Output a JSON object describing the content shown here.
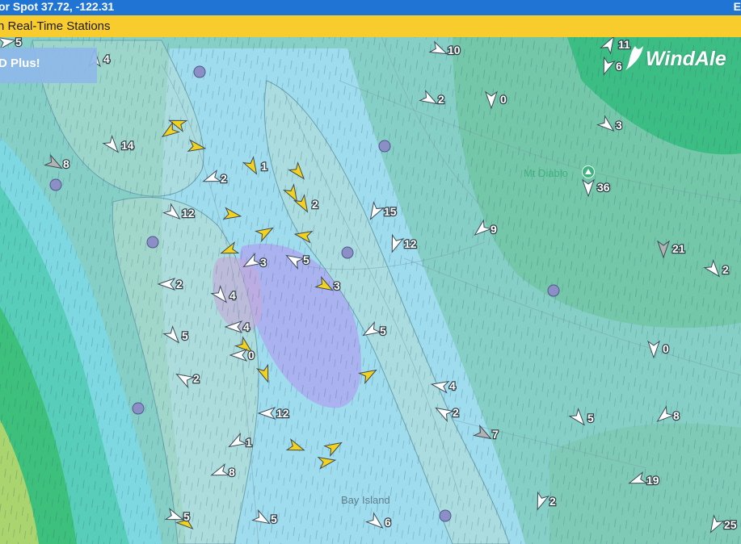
{
  "header": {
    "title": "or Spot 37.72, -122.31",
    "right_fragment": "E"
  },
  "station_bar": {
    "label": "n Real-Time Stations"
  },
  "promo": {
    "label": "D Plus!"
  },
  "logo": {
    "text": "WindAle"
  },
  "places": {
    "mt_diablo": "Mt Diablo",
    "bay_island": "Bay Island"
  },
  "colors": {
    "header_bg": "#1f74d4",
    "station_bar_bg": "#f8cc2d",
    "promo_bg": "#8eb8e8",
    "arrow_white": "#ffffff",
    "arrow_yellow": "#f2d21c",
    "arrow_grey": "#b2b2b2",
    "wind_speed_label": "#ffffff",
    "pin": "#8b8fc6"
  },
  "stations": [
    {
      "label": "5",
      "dir": 80,
      "color": "white"
    },
    {
      "label": "4",
      "dir": 0,
      "color": "white"
    },
    {
      "label": "10",
      "dir": 115,
      "color": "white"
    },
    {
      "label": "11",
      "dir": 30,
      "color": "white"
    },
    {
      "label": "6",
      "dir": 200,
      "color": "white"
    },
    {
      "label": "2",
      "dir": 120,
      "color": "white"
    },
    {
      "label": "0",
      "dir": 180,
      "color": "white"
    },
    {
      "label": "3",
      "dir": 130,
      "color": "white"
    },
    {
      "label": "14",
      "dir": 140,
      "color": "white"
    },
    {
      "label": "8",
      "dir": 120,
      "color": "grey"
    },
    {
      "label": "",
      "dir": 290,
      "color": "yellow"
    },
    {
      "label": "",
      "dir": 235,
      "color": "yellow"
    },
    {
      "label": "",
      "dir": 100,
      "color": "yellow"
    },
    {
      "label": "1",
      "dir": 150,
      "color": "yellow"
    },
    {
      "label": "2",
      "dir": 250,
      "color": "white"
    },
    {
      "label": "",
      "dir": 140,
      "color": "yellow"
    },
    {
      "label": "",
      "dir": 150,
      "color": "yellow"
    },
    {
      "label": "2",
      "dir": 150,
      "color": "yellow"
    },
    {
      "label": "36",
      "dir": 180,
      "color": "white"
    },
    {
      "label": "12",
      "dir": 130,
      "color": "white"
    },
    {
      "label": "",
      "dir": 100,
      "color": "yellow"
    },
    {
      "label": "15",
      "dir": 210,
      "color": "white"
    },
    {
      "label": "12",
      "dir": 200,
      "color": "white"
    },
    {
      "label": "9",
      "dir": 230,
      "color": "white"
    },
    {
      "label": "21",
      "dir": 180,
      "color": "grey"
    },
    {
      "label": "2",
      "dir": 140,
      "color": "white"
    },
    {
      "label": "",
      "dir": 60,
      "color": "yellow"
    },
    {
      "label": "",
      "dir": 280,
      "color": "yellow"
    },
    {
      "label": "",
      "dir": 250,
      "color": "yellow"
    },
    {
      "label": "3",
      "dir": 240,
      "color": "white"
    },
    {
      "label": "5",
      "dir": 300,
      "color": "white"
    },
    {
      "label": "3",
      "dir": 120,
      "color": "yellow"
    },
    {
      "label": "2",
      "dir": 270,
      "color": "white"
    },
    {
      "label": "4",
      "dir": 140,
      "color": "white"
    },
    {
      "label": "5",
      "dir": 240,
      "color": "white"
    },
    {
      "label": "4",
      "dir": 270,
      "color": "white"
    },
    {
      "label": "5",
      "dir": 140,
      "color": "white"
    },
    {
      "label": "",
      "dir": 130,
      "color": "yellow"
    },
    {
      "label": "0",
      "dir": 270,
      "color": "white"
    },
    {
      "label": "2",
      "dir": 300,
      "color": "white"
    },
    {
      "label": "",
      "dir": 160,
      "color": "yellow"
    },
    {
      "label": "",
      "dir": 60,
      "color": "yellow"
    },
    {
      "label": "4",
      "dir": 280,
      "color": "white"
    },
    {
      "label": "0",
      "dir": 180,
      "color": "white"
    },
    {
      "label": "12",
      "dir": 270,
      "color": "white"
    },
    {
      "label": "2",
      "dir": 300,
      "color": "white"
    },
    {
      "label": "7",
      "dir": 120,
      "color": "grey"
    },
    {
      "label": "5",
      "dir": 140,
      "color": "white"
    },
    {
      "label": "8",
      "dir": 230,
      "color": "white"
    },
    {
      "label": "1",
      "dir": 240,
      "color": "white"
    },
    {
      "label": "",
      "dir": 110,
      "color": "yellow"
    },
    {
      "label": "",
      "dir": 60,
      "color": "yellow"
    },
    {
      "label": "",
      "dir": 80,
      "color": "yellow"
    },
    {
      "label": "8",
      "dir": 250,
      "color": "white"
    },
    {
      "label": "19",
      "dir": 250,
      "color": "white"
    },
    {
      "label": "5",
      "dir": 120,
      "color": "white"
    },
    {
      "label": "6",
      "dir": 130,
      "color": "white"
    },
    {
      "label": "2",
      "dir": 200,
      "color": "white"
    },
    {
      "label": "",
      "dir": 130,
      "color": "yellow"
    },
    {
      "label": "5",
      "dir": 110,
      "color": "white"
    },
    {
      "label": "25",
      "dir": 210,
      "color": "white"
    }
  ]
}
